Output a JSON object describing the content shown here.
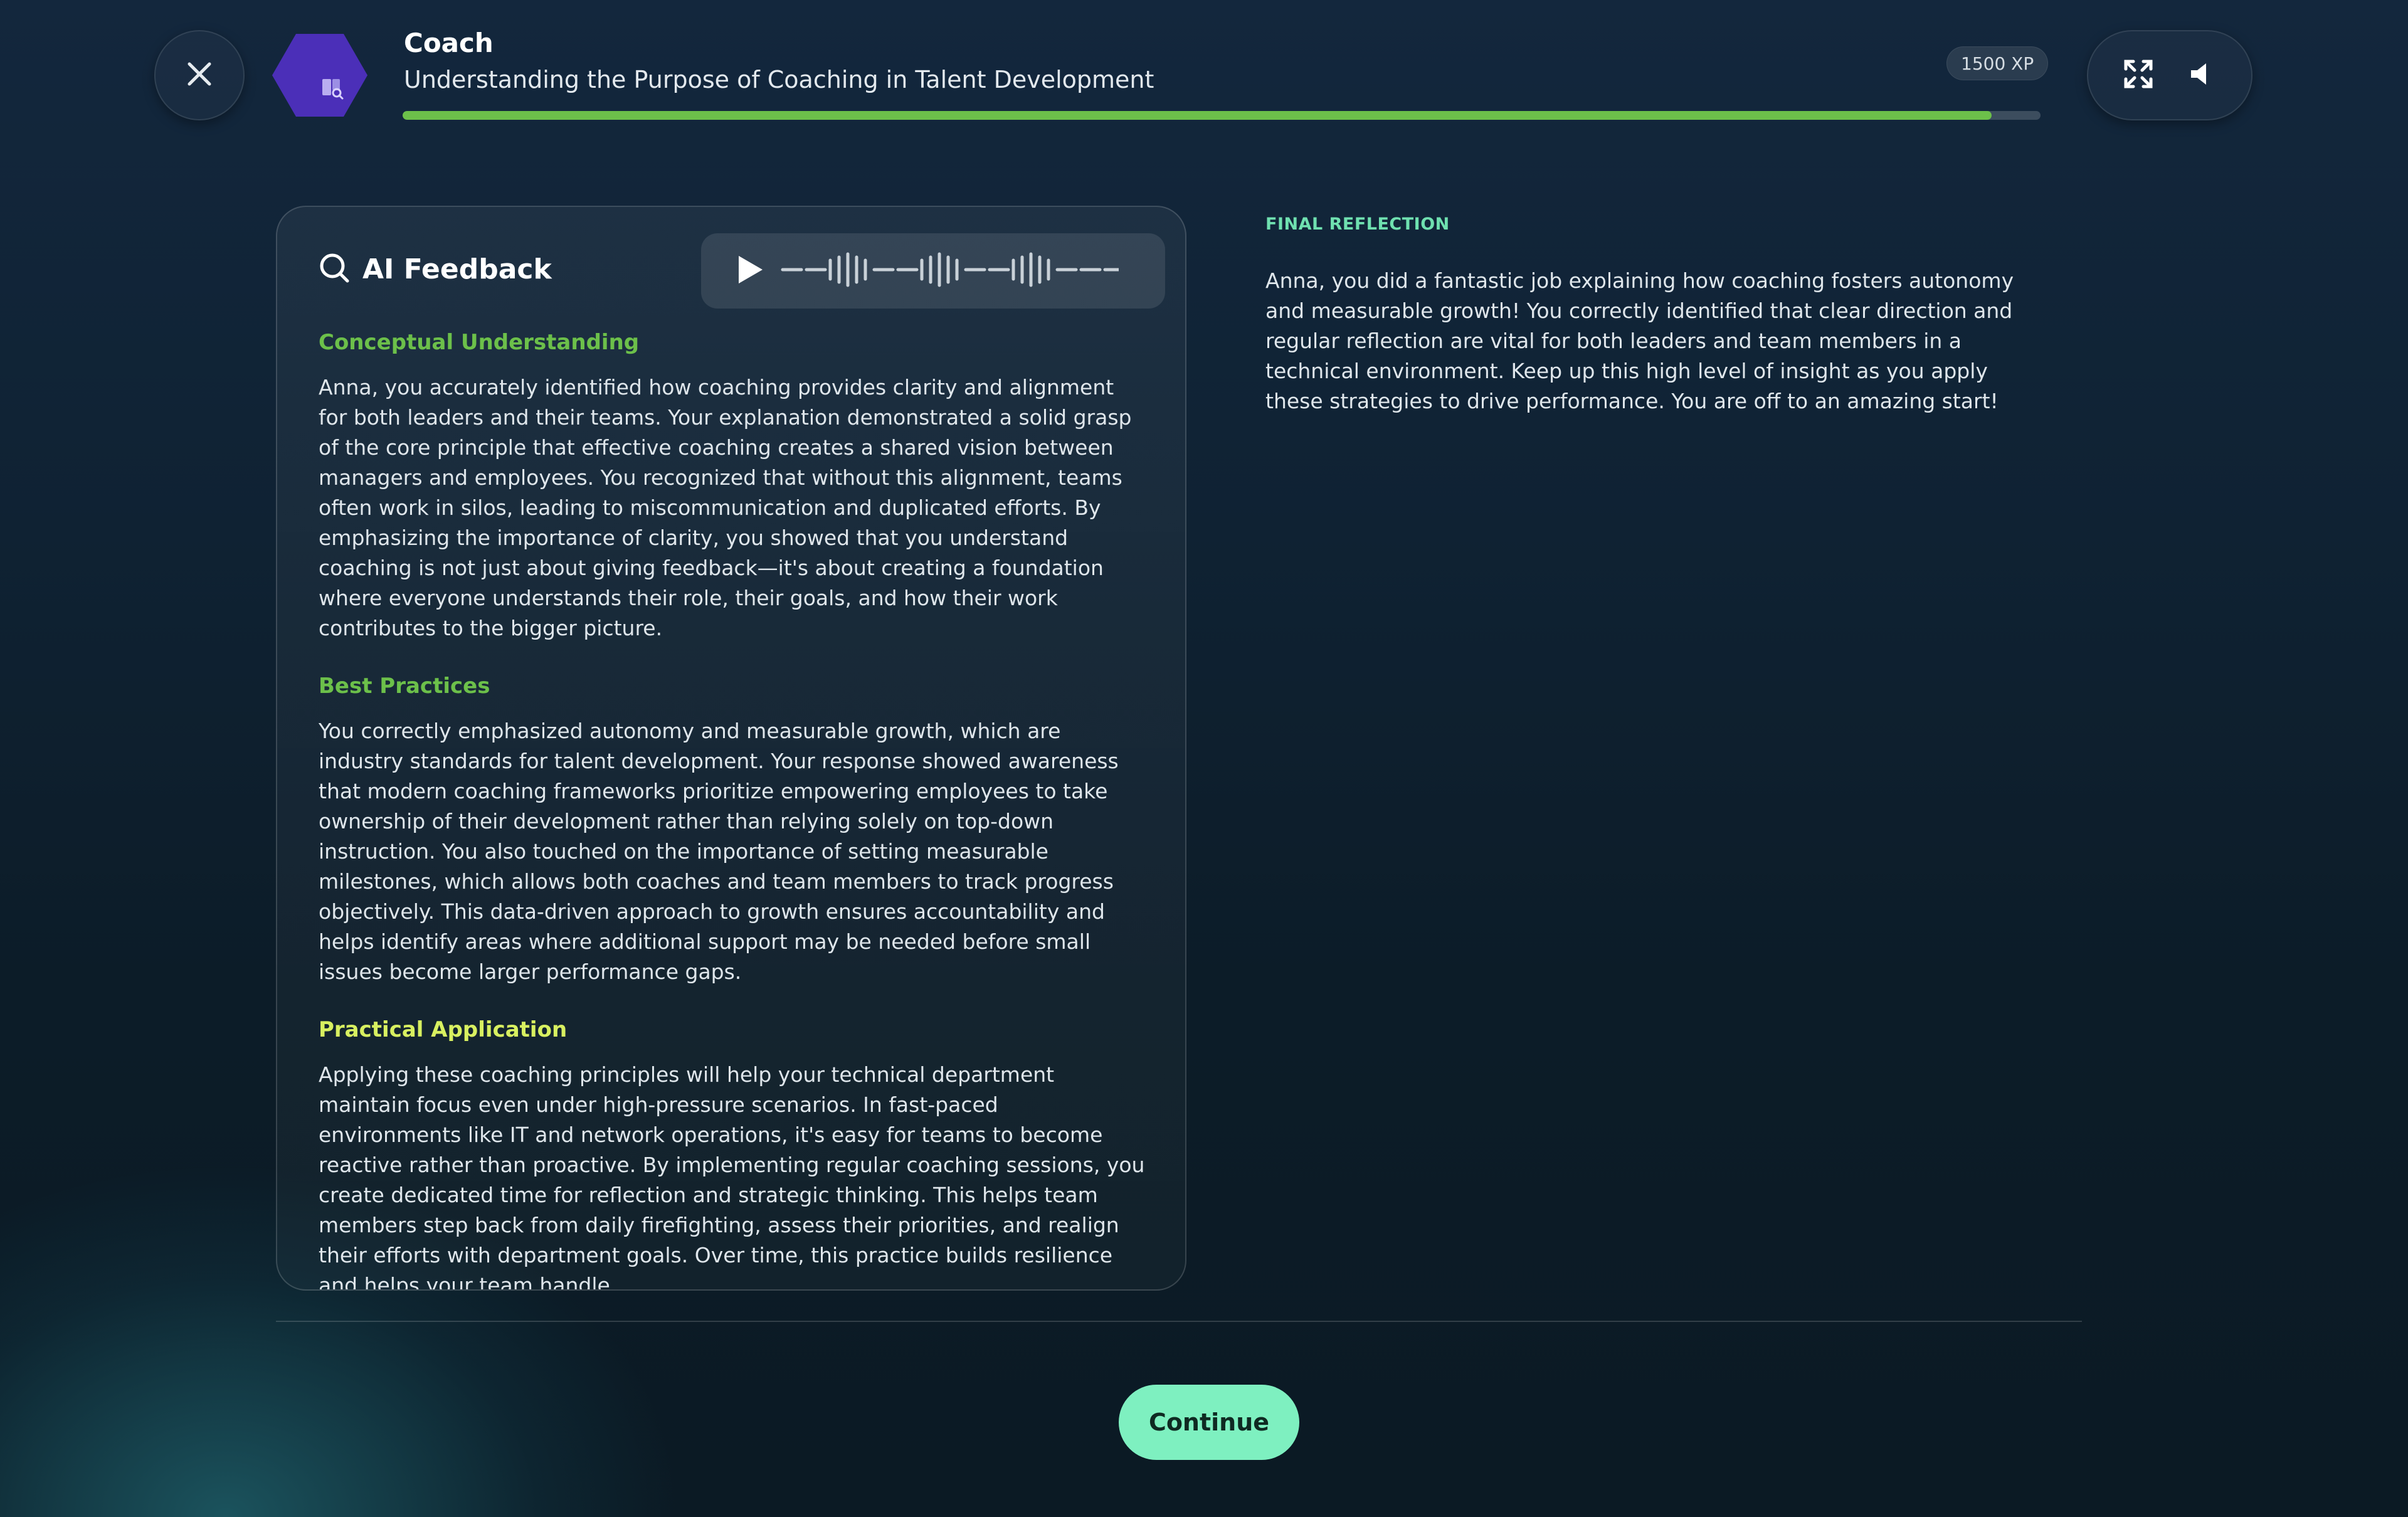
{
  "header": {
    "title": "Coach",
    "subtitle": "Understanding the Purpose of Coaching in Talent Development",
    "progress_percent": 97,
    "xp": "1500 XP",
    "icons": {
      "close": "close-icon",
      "badge": "coach-book-icon",
      "fullscreen": "fullscreen-icon",
      "sound": "speaker-icon"
    }
  },
  "feedback": {
    "title": "AI Feedback",
    "icons": {
      "search": "search-icon",
      "play": "play-icon",
      "waveform": "waveform-icon"
    },
    "sections": [
      {
        "heading": "Conceptual Understanding",
        "heading_color": "#6cc04a",
        "text": "Anna, you accurately identified how coaching provides clarity and alignment for both leaders and their teams. Your explanation demonstrated a solid grasp of the core principle that effective coaching creates a shared vision between managers and employees. You recognized that without this alignment, teams often work in silos, leading to miscommunication and duplicated efforts. By emphasizing the importance of clarity, you showed that you understand coaching is not just about giving feedback—it's about creating a foundation where everyone understands their role, their goals, and how their work contributes to the bigger picture."
      },
      {
        "heading": "Best Practices",
        "heading_color": "#6cc04a",
        "text": "You correctly emphasized autonomy and measurable growth, which are industry standards for talent development. Your response showed awareness that modern coaching frameworks prioritize empowering employees to take ownership of their development rather than relying solely on top-down instruction. You also touched on the importance of setting measurable milestones, which allows both coaches and team members to track progress objectively. This data-driven approach to growth ensures accountability and helps identify areas where additional support may be needed before small issues become larger performance gaps."
      },
      {
        "heading": "Practical Application",
        "heading_color": "#d8f060",
        "text": "Applying these coaching principles will help your technical department maintain focus even under high-pressure scenarios. In fast-paced environments like IT and network operations, it's easy for teams to become reactive rather than proactive. By implementing regular coaching sessions, you create dedicated time for reflection and strategic thinking. This helps team members step back from daily firefighting, assess their priorities, and realign their efforts with department goals. Over time, this practice builds resilience and helps your team handle"
      }
    ]
  },
  "reflection": {
    "label": "FINAL REFLECTION",
    "text": "Anna, you did a fantastic job explaining how coaching fosters autonomy and measurable growth! You correctly identified that clear direction and regular reflection are vital for both leaders and team members in a technical environment. Keep up this high level of insight as you apply these strategies to drive performance. You are off to an amazing start!"
  },
  "actions": {
    "continue_label": "Continue"
  },
  "colors": {
    "accent_green": "#6cc04a",
    "continue_bg": "#7ef0c0",
    "reflection_label": "#6fe0b0",
    "badge_purple": "#4b2fb8"
  }
}
